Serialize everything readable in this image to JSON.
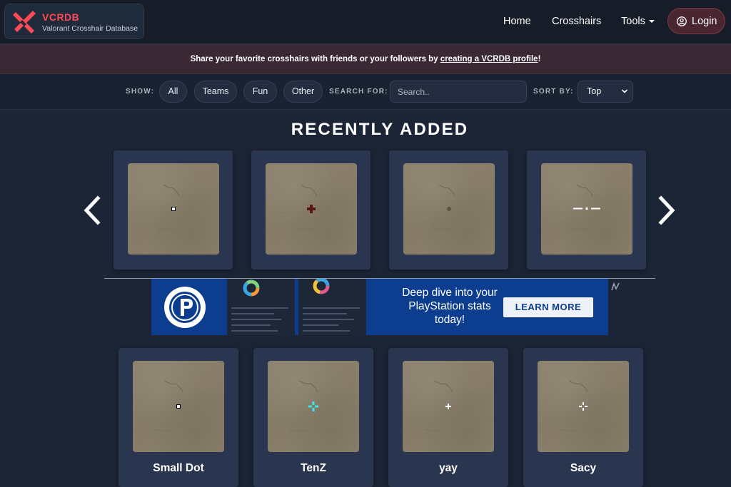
{
  "header": {
    "brand_title": "VCRDB",
    "brand_subtitle": "Valorant Crosshair Database",
    "brand_color": "#ff4a55",
    "nav": {
      "home": "Home",
      "crosshairs": "Crosshairs",
      "tools": "Tools",
      "login": "Login"
    }
  },
  "announcement": {
    "prefix": "Share your favorite crosshairs with friends or your followers by ",
    "link": "creating a VCRDB profile",
    "suffix": "!"
  },
  "filters": {
    "show_label": "SHOW:",
    "options": [
      "All",
      "Teams",
      "Fun",
      "Other"
    ],
    "search_label": "SEARCH FOR:",
    "search_placeholder": "Search..",
    "sort_label": "SORT BY:",
    "sort_value": "Top"
  },
  "section": {
    "title": "RECENTLY ADDED"
  },
  "carousel": {
    "items": [
      {
        "crosshair": "small-dot-outline"
      },
      {
        "crosshair": "dark-red-plus"
      },
      {
        "crosshair": "faint-dot"
      },
      {
        "crosshair": "white-lines-dot"
      }
    ]
  },
  "ad": {
    "copy": "Deep dive into your PlayStation stats today!",
    "button": "LEARN MORE",
    "background": "#0c3d8f"
  },
  "crosshairs": [
    {
      "name": "Small Dot",
      "crosshair": "small-dot-outline"
    },
    {
      "name": "TenZ",
      "crosshair": "cyan-gap-plus"
    },
    {
      "name": "yay",
      "crosshair": "white-plus"
    },
    {
      "name": "Sacy",
      "crosshair": "white-gap-plus"
    }
  ]
}
